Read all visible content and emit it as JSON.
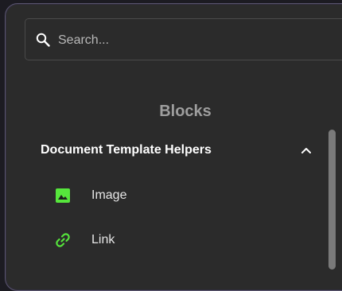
{
  "search": {
    "placeholder": "Search..."
  },
  "section": {
    "title": "Blocks"
  },
  "group": {
    "label": "Document Template Helpers",
    "items": [
      {
        "label": "Image",
        "icon": "image-icon"
      },
      {
        "label": "Link",
        "icon": "link-icon"
      }
    ]
  },
  "colors": {
    "accent": "#56e63c",
    "panel": "#2b2b2b",
    "background": "#1c1b22"
  }
}
